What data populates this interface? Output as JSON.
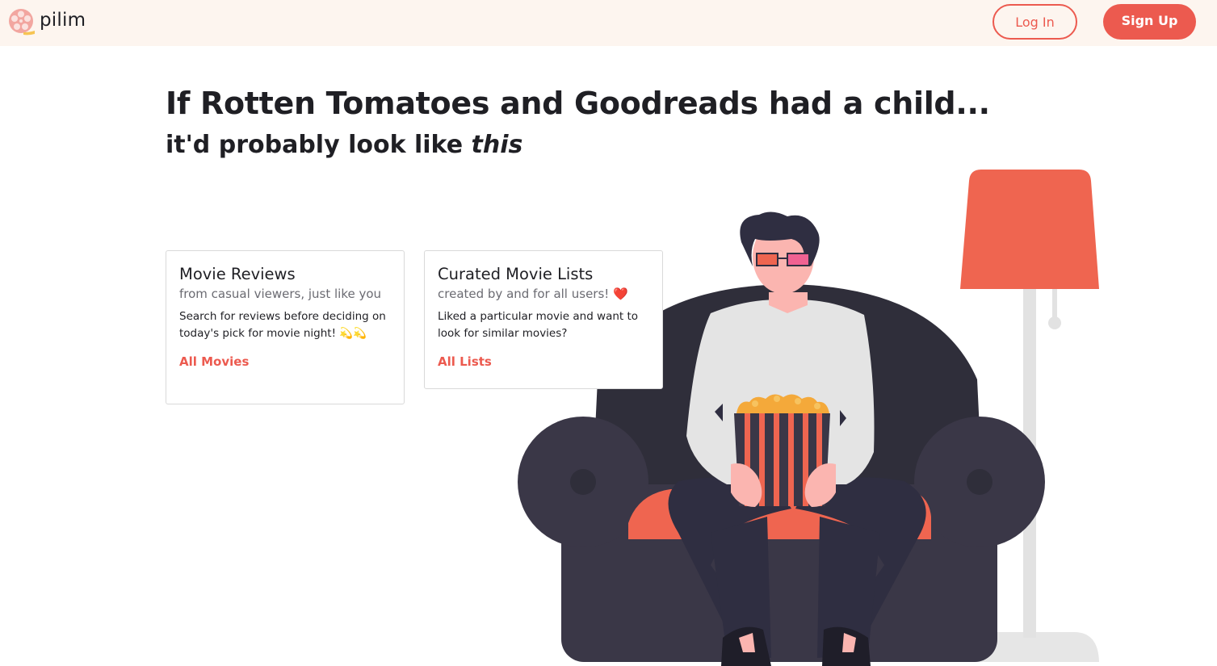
{
  "brand": {
    "name": "pilim"
  },
  "nav": {
    "login_label": "Log In",
    "signup_label": "Sign Up"
  },
  "hero": {
    "title": "If Rotten Tomatoes and Goodreads had a child...",
    "subtitle_prefix": "it'd probably look like ",
    "subtitle_emphasis": "this"
  },
  "cards": [
    {
      "title": "Movie Reviews",
      "subtitle": "from casual viewers, just like you",
      "text": "Search for reviews before deciding on today's pick for movie night! 💫💫",
      "link": "All Movies"
    },
    {
      "title": "Curated Movie Lists",
      "subtitle": "created by and for all users! ❤️",
      "text": "Liked a particular movie and want to look for similar movies?",
      "link": "All Lists"
    }
  ],
  "colors": {
    "accent": "#ec5a4f",
    "nav_background": "#fdf5ef",
    "armchair": "#3a3747",
    "lamp_shade": "#ef6550"
  }
}
